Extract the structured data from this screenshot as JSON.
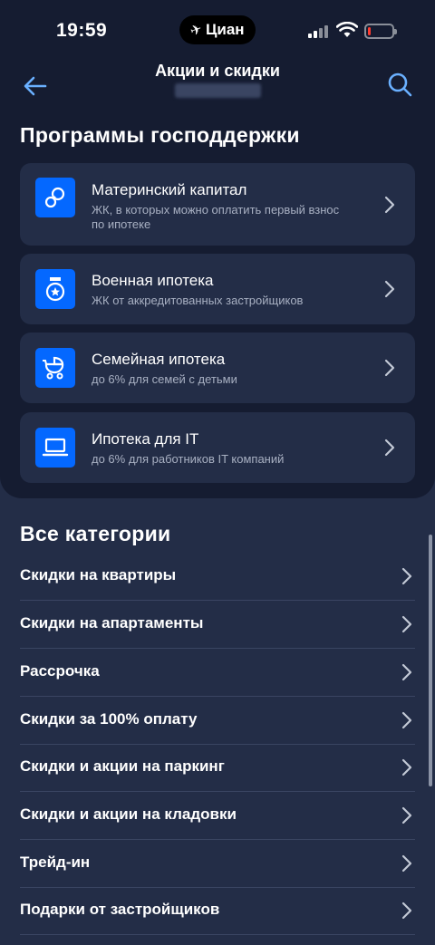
{
  "status_bar": {
    "time": "19:59",
    "island_logo": "Циан",
    "battery_level": 0.12,
    "battery_color": "#ff3b30"
  },
  "header": {
    "title": "Акции и скидки",
    "back_icon": "arrow-left-icon",
    "search_icon": "search-icon"
  },
  "gov_programs": {
    "title": "Программы господдержки",
    "items": [
      {
        "title": "Материнский капитал",
        "desc": "ЖК, в которых можно оплатить первый взнос по ипотеке",
        "icon": "pacifier-icon"
      },
      {
        "title": "Военная ипотека",
        "desc": "ЖК от аккредитованных застройщиков",
        "icon": "medal-icon"
      },
      {
        "title": "Семейная ипотека",
        "desc": "до 6% для семей с детьми",
        "icon": "stroller-icon"
      },
      {
        "title": "Ипотека для IT",
        "desc": "до 6% для работников IT компаний",
        "icon": "laptop-icon"
      }
    ]
  },
  "categories": {
    "title": "Все категории",
    "items": [
      "Скидки на квартиры",
      "Скидки на апартаменты",
      "Рассрочка",
      "Скидки за 100% оплату",
      "Скидки и акции на паркинг",
      "Скидки и акции на кладовки",
      "Трейд-ин",
      "Подарки от застройщиков"
    ]
  },
  "colors": {
    "accent": "#0468ff",
    "panel_bg": "#151c31",
    "card_bg": "#232d47",
    "secondary_text": "#a8b0c2"
  }
}
